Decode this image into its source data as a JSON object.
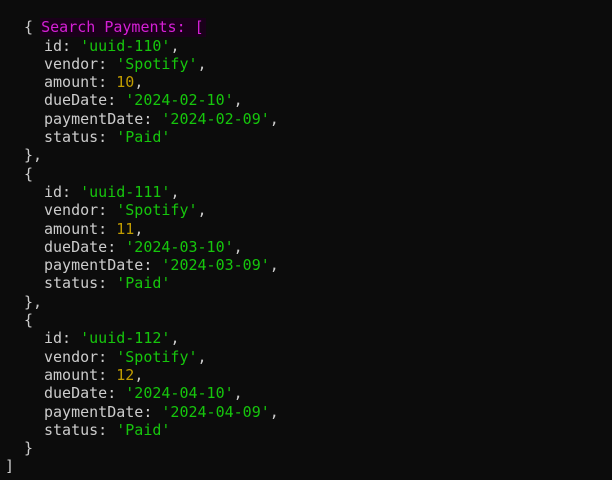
{
  "header": {
    "label": "Search Payments: ["
  },
  "records": [
    {
      "id": "'uuid-110'",
      "vendor": "'Spotify'",
      "amount": "10",
      "dueDate": "'2024-02-10'",
      "paymentDate": "'2024-02-09'",
      "status": "'Paid'",
      "close": "},"
    },
    {
      "id": "'uuid-111'",
      "vendor": "'Spotify'",
      "amount": "11",
      "dueDate": "'2024-03-10'",
      "paymentDate": "'2024-03-09'",
      "status": "'Paid'",
      "close": "},"
    },
    {
      "id": "'uuid-112'",
      "vendor": "'Spotify'",
      "amount": "12",
      "dueDate": "'2024-04-10'",
      "paymentDate": "'2024-04-09'",
      "status": "'Paid'",
      "close": "}"
    }
  ],
  "keys": {
    "id": "id: ",
    "vendor": "vendor: ",
    "amount": "amount: ",
    "dueDate": "dueDate: ",
    "paymentDate": "paymentDate: ",
    "status": "status: "
  },
  "open_brace": "{",
  "comma": ",",
  "closing_bracket": "]",
  "colors": {
    "background": "#0c0c0c",
    "header": "#d61fd6",
    "string": "#16c60c",
    "number": "#c19c00",
    "text": "#cccccc"
  }
}
